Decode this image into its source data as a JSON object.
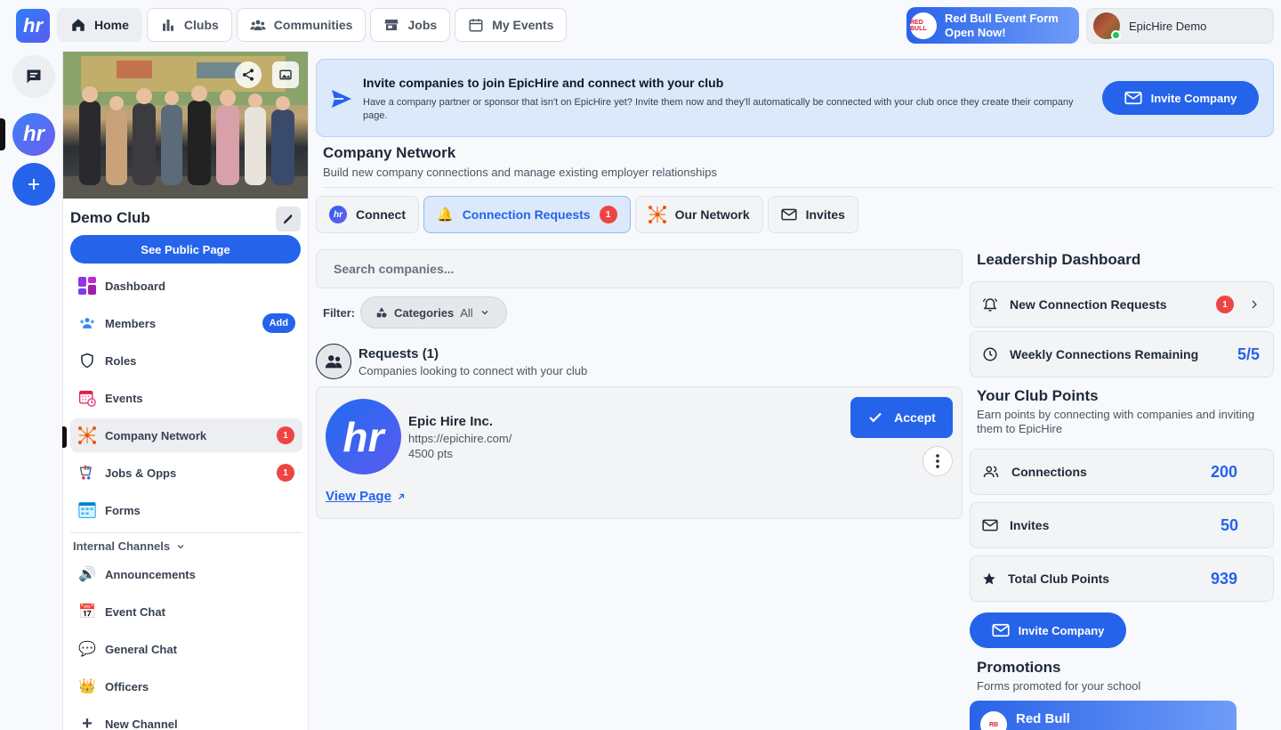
{
  "topbar": {
    "nav": [
      {
        "label": "Home",
        "icon": "home-icon"
      },
      {
        "label": "Clubs",
        "icon": "bar-chart-icon"
      },
      {
        "label": "Communities",
        "icon": "users-icon"
      },
      {
        "label": "Jobs",
        "icon": "store-icon"
      },
      {
        "label": "My Events",
        "icon": "calendar-icon"
      }
    ],
    "promo_line1": "Red Bull Event Form",
    "promo_line2": "Open Now!",
    "user_name": "EpicHire Demo"
  },
  "sidebar": {
    "club_name": "Demo Club",
    "public_page_label": "See Public Page",
    "items": [
      {
        "label": "Dashboard",
        "icon": "dashboard-icon"
      },
      {
        "label": "Members",
        "icon": "members-icon",
        "action": "Add"
      },
      {
        "label": "Roles",
        "icon": "shield-icon"
      },
      {
        "label": "Events",
        "icon": "calendar-clock-icon"
      },
      {
        "label": "Company Network",
        "icon": "network-icon",
        "badge": "1"
      },
      {
        "label": "Jobs & Opps",
        "icon": "jobs-icon",
        "badge": "1"
      },
      {
        "label": "Forms",
        "icon": "forms-icon"
      }
    ],
    "channels_header": "Internal Channels",
    "channels": [
      {
        "label": "Announcements",
        "icon": "🔊"
      },
      {
        "label": "Event Chat",
        "icon": "📅"
      },
      {
        "label": "General Chat",
        "icon": "💬"
      },
      {
        "label": "Officers",
        "icon": "👑"
      },
      {
        "label": "New Channel",
        "icon": "+"
      }
    ]
  },
  "banner": {
    "title": "Invite companies to join EpicHire and connect with your club",
    "description": "Have a company partner or sponsor that isn't on EpicHire yet? Invite them now and they'll automatically be connected with your club once they create their company page.",
    "button": "Invite Company"
  },
  "page": {
    "title": "Company Network",
    "subtitle": "Build new company connections and manage existing employer relationships"
  },
  "tabs": [
    {
      "label": "Connect"
    },
    {
      "label": "Connection Requests",
      "badge": "1"
    },
    {
      "label": "Our Network"
    },
    {
      "label": "Invites"
    }
  ],
  "search": {
    "placeholder": "Search companies..."
  },
  "filter": {
    "label": "Filter:",
    "categories_label": "Categories",
    "categories_value": "All"
  },
  "requests": {
    "title": "Requests (1)",
    "subtitle": "Companies looking to connect with your club",
    "items": [
      {
        "name": "Epic Hire Inc.",
        "url": "https://epichire.com/",
        "points": "4500 pts",
        "accept": "Accept",
        "view": "View Page"
      }
    ]
  },
  "dashboard": {
    "title": "Leadership Dashboard",
    "new_requests_label": "New Connection Requests",
    "new_requests_badge": "1",
    "weekly_label": "Weekly Connections Remaining",
    "weekly_value": "5/5"
  },
  "points": {
    "title": "Your Club Points",
    "subtitle": "Earn points by connecting with companies and inviting them to EpicHire",
    "connections_label": "Connections",
    "connections_value": "200",
    "invites_label": "Invites",
    "invites_value": "50",
    "total_label": "Total Club Points",
    "total_value": "939",
    "invite_button": "Invite Company"
  },
  "promotions": {
    "title": "Promotions",
    "subtitle": "Forms promoted for your school",
    "card_title": "Red Bull"
  },
  "colors": {
    "accent": "#2563eb",
    "badge": "#ef4444",
    "banner_bg": "#dbe9fb"
  }
}
